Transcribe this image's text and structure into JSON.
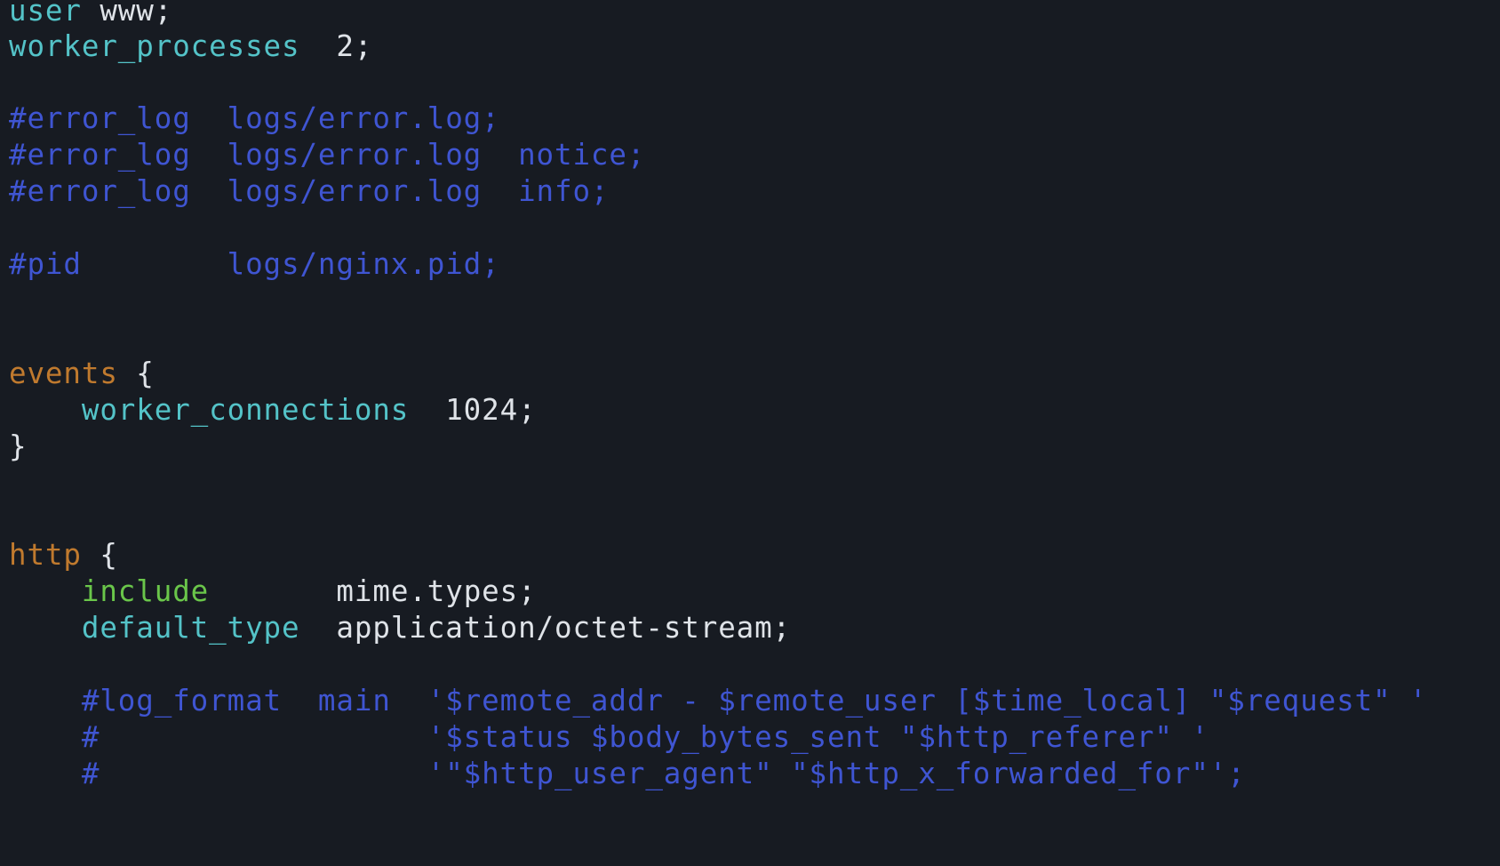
{
  "editor": {
    "lines": [
      [
        {
          "text": "user",
          "c": "tok-teal"
        },
        {
          "text": " www;",
          "c": "tok-white"
        }
      ],
      [
        {
          "text": "worker_processes",
          "c": "tok-teal"
        },
        {
          "text": "  2;",
          "c": "tok-white"
        }
      ],
      [],
      [
        {
          "text": "#error_log  logs/error.log;",
          "c": "tok-comment"
        }
      ],
      [
        {
          "text": "#error_log  logs/error.log  notice;",
          "c": "tok-comment"
        }
      ],
      [
        {
          "text": "#error_log  logs/error.log  info;",
          "c": "tok-comment"
        }
      ],
      [],
      [
        {
          "text": "#pid        logs/nginx.pid;",
          "c": "tok-comment"
        }
      ],
      [],
      [],
      [
        {
          "text": "events",
          "c": "tok-orange"
        },
        {
          "text": " {",
          "c": "tok-white"
        }
      ],
      [
        {
          "text": "    ",
          "c": "tok-white"
        },
        {
          "text": "worker_connections",
          "c": "tok-teal"
        },
        {
          "text": "  1024;",
          "c": "tok-white"
        }
      ],
      [
        {
          "text": "}",
          "c": "tok-white"
        }
      ],
      [],
      [],
      [
        {
          "text": "http",
          "c": "tok-orange"
        },
        {
          "text": " {",
          "c": "tok-white"
        }
      ],
      [
        {
          "text": "    ",
          "c": "tok-white"
        },
        {
          "text": "include",
          "c": "tok-green"
        },
        {
          "text": "       mime.types;",
          "c": "tok-white"
        }
      ],
      [
        {
          "text": "    ",
          "c": "tok-white"
        },
        {
          "text": "default_type",
          "c": "tok-teal"
        },
        {
          "text": "  application/octet-stream;",
          "c": "tok-white"
        }
      ],
      [],
      [
        {
          "text": "    #log_format  main  '$remote_addr - $remote_user [$time_local] \"$request\" '",
          "c": "tok-comment"
        }
      ],
      [
        {
          "text": "    #                  '$status $body_bytes_sent \"$http_referer\" '",
          "c": "tok-comment"
        }
      ],
      [
        {
          "text": "    #                  '\"$http_user_agent\" \"$http_x_forwarded_for\"';",
          "c": "tok-comment"
        }
      ]
    ]
  },
  "colors": {
    "background": "#171b22",
    "plain": "#dfe3e8",
    "directive": "#54c3c8",
    "comment": "#3f55d2",
    "block": "#c07a2e",
    "include": "#6ac64a"
  }
}
